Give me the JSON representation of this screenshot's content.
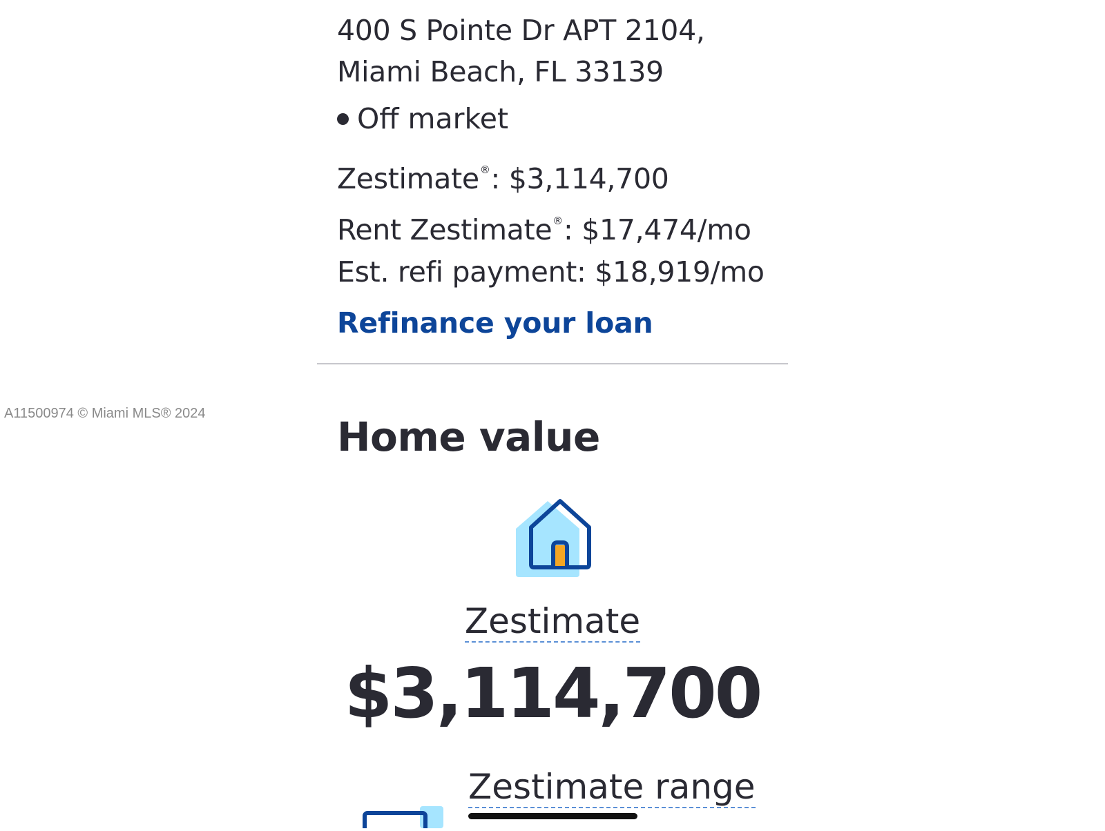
{
  "address": {
    "line1": "400 S Pointe Dr APT 2104,",
    "line2": "Miami Beach, FL 33139"
  },
  "status": {
    "label": "Off market"
  },
  "summary": {
    "zestimate_label": "Zestimate",
    "zestimate_value": ": $3,114,700",
    "rent_label": "Rent Zestimate",
    "rent_value": ": $17,474/mo",
    "refi_text": "Est. refi payment: $18,919/mo",
    "registered_mark": "®"
  },
  "links": {
    "refinance": "Refinance your loan"
  },
  "watermark": "A11500974 © Miami MLS® 2024",
  "home_value": {
    "heading": "Home value",
    "icon": "house-icon",
    "zestimate_label": "Zestimate",
    "zestimate_amount": "$3,114,700",
    "range_label": "Zestimate range",
    "range_icon": "range-chart-icon"
  },
  "colors": {
    "text": "#2a2a33",
    "link": "#0d4599",
    "icon_light_blue": "#a6e5ff",
    "icon_dark_blue": "#0d4599",
    "icon_door": "#f5a623",
    "divider": "#c7c7cc"
  }
}
